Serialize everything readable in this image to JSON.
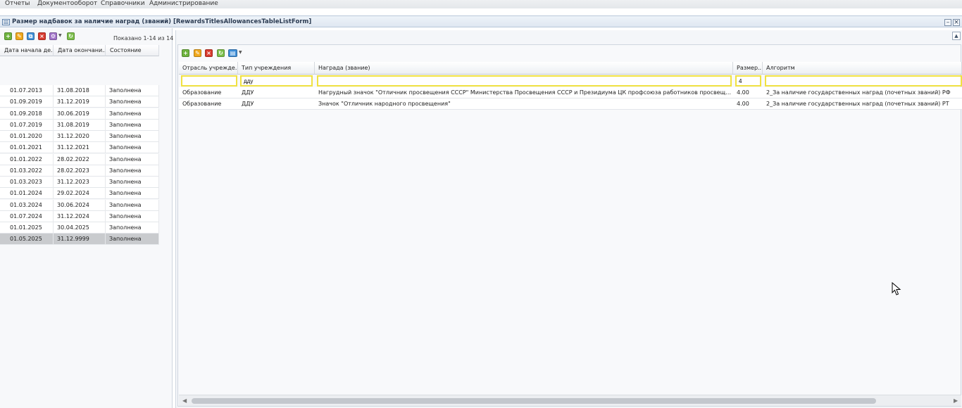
{
  "menu": [
    "Отчеты",
    "Документооборот",
    "Справочники",
    "Администрирование"
  ],
  "window": {
    "title": "Размер надбавок за наличие наград (званий) [RewardsTitlesAllowancesTableListForm]"
  },
  "left": {
    "shown": "Показано 1-14 из 14",
    "columns": [
      "Дата начала де...",
      "Дата окончани...",
      "Состояние"
    ],
    "rows": [
      [
        "01.07.2013",
        "31.08.2018",
        "Заполнена"
      ],
      [
        "01.09.2019",
        "31.12.2019",
        "Заполнена"
      ],
      [
        "01.09.2018",
        "30.06.2019",
        "Заполнена"
      ],
      [
        "01.07.2019",
        "31.08.2019",
        "Заполнена"
      ],
      [
        "01.01.2020",
        "31.12.2020",
        "Заполнена"
      ],
      [
        "01.01.2021",
        "31.12.2021",
        "Заполнена"
      ],
      [
        "01.01.2022",
        "28.02.2022",
        "Заполнена"
      ],
      [
        "01.03.2022",
        "28.02.2023",
        "Заполнена"
      ],
      [
        "01.03.2023",
        "31.12.2023",
        "Заполнена"
      ],
      [
        "01.01.2024",
        "29.02.2024",
        "Заполнена"
      ],
      [
        "01.03.2024",
        "30.06.2024",
        "Заполнена"
      ],
      [
        "01.07.2024",
        "31.12.2024",
        "Заполнена"
      ],
      [
        "01.01.2025",
        "30.04.2025",
        "Заполнена"
      ],
      [
        "01.05.2025",
        "31.12.9999",
        "Заполнена"
      ]
    ],
    "selected_index": 13
  },
  "right": {
    "columns": [
      "Отрасль учрежде...",
      "Тип учреждения",
      "Награда (звание)",
      "Размер...",
      "Алгоритм"
    ],
    "filters": [
      "",
      "дду",
      "",
      "4",
      ""
    ],
    "rows": [
      [
        "Образование",
        "ДДУ",
        "Нагрудный значок \"Отличник просвещения СССР\" Министерства Просвещения СССР и Президиума ЦК профсоюза работников просвещения, высшей ...",
        "4.00",
        "2_За наличие государственных наград (почетных званий) РФ"
      ],
      [
        "Образование",
        "ДДУ",
        "Значок \"Отличник народного просвещения\"",
        "4.00",
        "2_За наличие государственных наград (почетных званий) РТ"
      ]
    ]
  },
  "icons": [
    "add-icon",
    "edit-icon",
    "copy-icon",
    "delete-icon",
    "settings-icon",
    "refresh-icon",
    "print-icon",
    "collapse-icon",
    "minimize-icon",
    "close-icon",
    "mouse-cursor-icon"
  ]
}
